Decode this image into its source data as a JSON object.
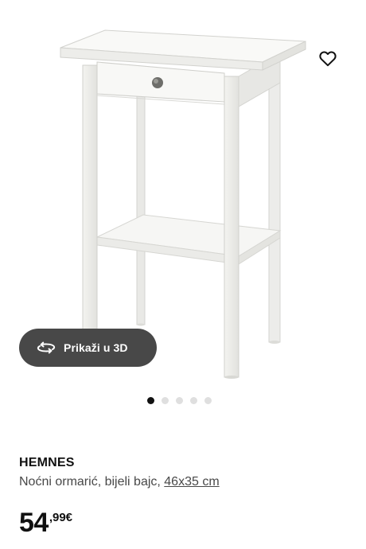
{
  "product": {
    "name": "HEMNES",
    "description": "Noćni ormarić, bijeli bajc, ",
    "size": "46x35 cm",
    "price_whole": "54",
    "price_decimal": ",99€"
  },
  "view3d": {
    "label": "Prikaži u 3D",
    "icon": "3d-rotate-icon"
  },
  "favorite": {
    "icon": "heart-icon"
  },
  "carousel": {
    "total": 5,
    "active": 1
  },
  "colors": {
    "accent_dark": "#111111",
    "button_bg": "#484848",
    "dot_inactive": "#dfdfdf"
  }
}
